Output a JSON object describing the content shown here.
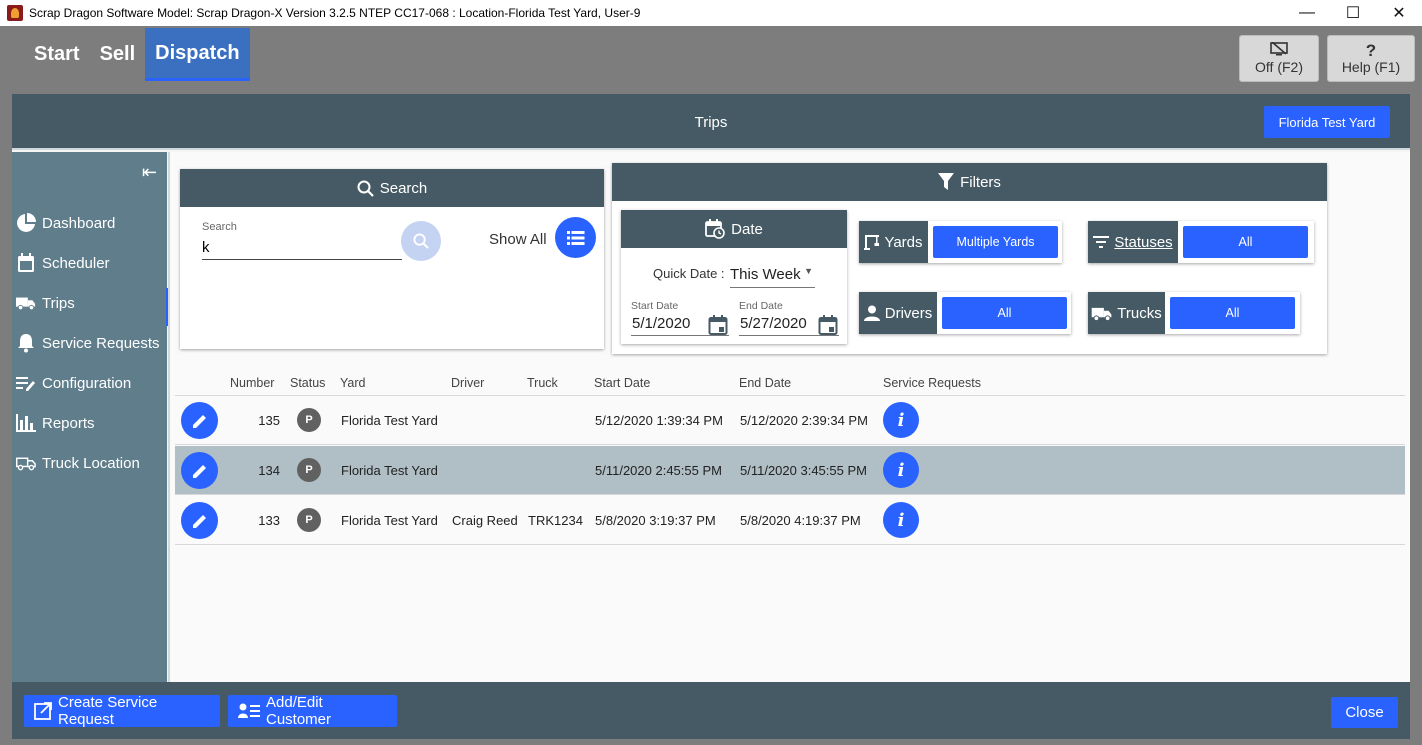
{
  "window": {
    "title": "Scrap Dragon Software Model: Scrap Dragon-X Version 3.2.5 NTEP CC17-068 : Location-Florida Test Yard, User-9",
    "minimize": "—",
    "maximize": "☐",
    "close": "✕"
  },
  "nav": {
    "tabs": [
      "Start",
      "Sell",
      "Dispatch"
    ],
    "active": "Dispatch"
  },
  "top_buttons": {
    "off_label": "Off (F2)",
    "help_label": "Help (F1)",
    "help_glyph": "?"
  },
  "header": {
    "title": "Trips",
    "yard_button": "Florida Test Yard"
  },
  "sidebar": {
    "collapse_glyph": "⇤",
    "items": [
      {
        "label": "Dashboard",
        "icon": "pie-chart-icon"
      },
      {
        "label": "Scheduler",
        "icon": "calendar-icon"
      },
      {
        "label": "Trips",
        "icon": "truck-icon"
      },
      {
        "label": "Service Requests",
        "icon": "bell-icon"
      },
      {
        "label": "Configuration",
        "icon": "edit-list-icon"
      },
      {
        "label": "Reports",
        "icon": "bar-chart-icon"
      },
      {
        "label": "Truck Location",
        "icon": "truck-location-icon"
      }
    ],
    "active": "Trips"
  },
  "search": {
    "header": "Search",
    "field_label": "Search",
    "value": "k",
    "show_all": "Show All"
  },
  "filters": {
    "header": "Filters",
    "date": {
      "header": "Date",
      "quick_date_label": "Quick Date :",
      "quick_date_value": "This Week",
      "start_label": "Start Date",
      "start_value": "5/1/2020",
      "end_label": "End Date",
      "end_value": "5/27/2020"
    },
    "yards": {
      "label": "Yards",
      "value": "Multiple Yards"
    },
    "statuses": {
      "label": "Statuses",
      "value": "All"
    },
    "drivers": {
      "label": "Drivers",
      "value": "All"
    },
    "trucks": {
      "label": "Trucks",
      "value": "All"
    }
  },
  "table": {
    "columns": [
      "Number",
      "Status",
      "Yard",
      "Driver",
      "Truck",
      "Start Date",
      "End Date",
      "Service Requests"
    ],
    "rows": [
      {
        "number": "135",
        "status": "P",
        "yard": "Florida Test Yard",
        "driver": "",
        "truck": "",
        "start": "5/12/2020 1:39:34 PM",
        "end": "5/12/2020 2:39:34 PM",
        "info": "i"
      },
      {
        "number": "134",
        "status": "P",
        "yard": "Florida Test Yard",
        "driver": "",
        "truck": "",
        "start": "5/11/2020 2:45:55 PM",
        "end": "5/11/2020 3:45:55 PM",
        "info": "i"
      },
      {
        "number": "133",
        "status": "P",
        "yard": "Florida Test Yard",
        "driver": "Craig Reed",
        "truck": "TRK1234",
        "start": "5/8/2020 3:19:37 PM",
        "end": "5/8/2020 4:19:37 PM",
        "info": "i"
      }
    ],
    "selected_row": 1
  },
  "footer": {
    "create_service_request": "Create Service Request",
    "add_edit_customer": "Add/Edit Customer",
    "close": "Close"
  },
  "colors": {
    "accent": "#2962ff",
    "header": "#455a64",
    "sidebar": "#607d8b",
    "selected_row": "#b0bec5"
  }
}
